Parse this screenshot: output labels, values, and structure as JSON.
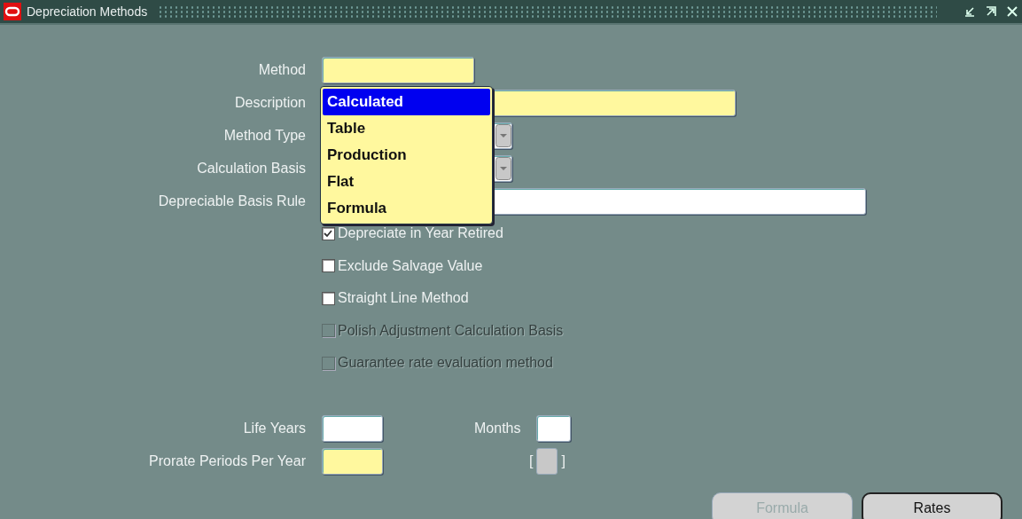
{
  "window": {
    "title": "Depreciation Methods"
  },
  "fields": [
    {
      "label": "Method",
      "kind": "text",
      "required": true
    },
    {
      "label": "Description",
      "kind": "text",
      "required": true
    },
    {
      "label": "Method Type",
      "kind": "select",
      "required": false
    },
    {
      "label": "Calculation Basis",
      "kind": "select",
      "required": false
    },
    {
      "label": "Depreciable Basis Rule",
      "kind": "text",
      "required": false
    }
  ],
  "popup": {
    "items": [
      {
        "label": "Calculated",
        "selected": true
      },
      {
        "label": "Table",
        "selected": false
      },
      {
        "label": "Production",
        "selected": false
      },
      {
        "label": "Flat",
        "selected": false
      },
      {
        "label": "Formula",
        "selected": false
      }
    ]
  },
  "checkboxes": [
    {
      "label": "Depreciate in Year Retired",
      "checked": true,
      "disabled": false
    },
    {
      "label": "Exclude Salvage Value",
      "checked": false,
      "disabled": false
    },
    {
      "label": "Straight Line Method",
      "checked": false,
      "disabled": false
    },
    {
      "label": "Polish Adjustment Calculation Basis",
      "checked": false,
      "disabled": true
    },
    {
      "label": "Guarantee rate evaluation method",
      "checked": false,
      "disabled": true
    }
  ],
  "life": {
    "years_label": "Life Years",
    "years_required": false,
    "months_label": "Months",
    "months_required": false
  },
  "prorate": {
    "label": "Prorate Periods Per Year",
    "required": true,
    "bracket_open": "[",
    "bracket_close": "]"
  },
  "buttons": [
    {
      "label": "Formula",
      "disabled": true
    },
    {
      "label": "Rates",
      "disabled": false
    }
  ]
}
